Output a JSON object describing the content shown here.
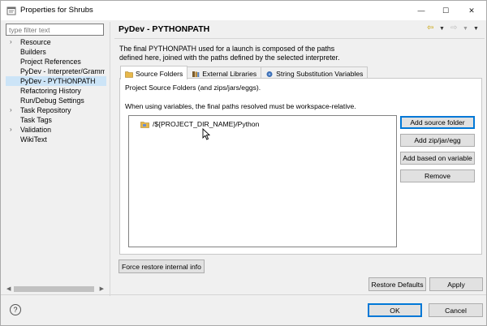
{
  "window": {
    "title": "Properties for Shrubs",
    "minimize_glyph": "—",
    "maximize_glyph": "☐",
    "close_glyph": "✕"
  },
  "filter": {
    "placeholder": "type filter text"
  },
  "tree": {
    "items": [
      {
        "label": "Resource",
        "expandable": true
      },
      {
        "label": "Builders",
        "expandable": false
      },
      {
        "label": "Project References",
        "expandable": false
      },
      {
        "label": "PyDev - Interpreter/Gramm",
        "expandable": false
      },
      {
        "label": "PyDev - PYTHONPATH",
        "expandable": false,
        "selected": true
      },
      {
        "label": "Refactoring History",
        "expandable": false
      },
      {
        "label": "Run/Debug Settings",
        "expandable": false
      },
      {
        "label": "Task Repository",
        "expandable": true
      },
      {
        "label": "Task Tags",
        "expandable": false
      },
      {
        "label": "Validation",
        "expandable": true
      },
      {
        "label": "WikiText",
        "expandable": false
      }
    ]
  },
  "page": {
    "title": "PyDev - PYTHONPATH",
    "description_line1": "The final PYTHONPATH used for a launch is composed of the paths",
    "description_line2": "defined here, joined with the paths defined by the selected interpreter."
  },
  "tabs": [
    {
      "label": "Source Folders",
      "icon": "folder-icon",
      "active": true
    },
    {
      "label": "External Libraries",
      "icon": "library-icon",
      "active": false
    },
    {
      "label": "String Substitution Variables",
      "icon": "variable-icon",
      "active": false
    }
  ],
  "source_folders": {
    "header": "Project Source Folders (and zips/jars/eggs).",
    "note": "When using variables, the final paths resolved must be workspace-relative.",
    "entries": [
      "/${PROJECT_DIR_NAME}/Python"
    ],
    "buttons": {
      "add_source_folder": "Add source folder",
      "add_zip": "Add zip/jar/egg",
      "add_variable": "Add based on variable",
      "remove": "Remove"
    }
  },
  "force_restore": "Force restore internal info",
  "restore_defaults": "Restore Defaults",
  "apply": "Apply",
  "ok": "OK",
  "cancel": "Cancel",
  "help_glyph": "?",
  "colors": {
    "selection": "#cce4f7",
    "focus_border": "#0078d7",
    "nav_arrow": "#c8a000",
    "folder": "#e8b84a"
  }
}
